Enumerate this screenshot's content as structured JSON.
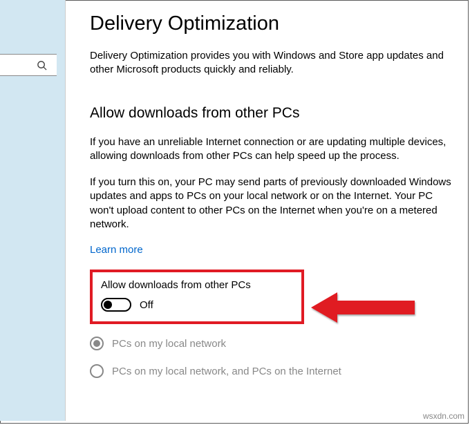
{
  "header": {
    "title": "Delivery Optimization"
  },
  "intro": "Delivery Optimization provides you with Windows and Store app updates and other Microsoft products quickly and reliably.",
  "section": {
    "title": "Allow downloads from other PCs",
    "para1": "If you have an unreliable Internet connection or are updating multiple devices, allowing downloads from other PCs can help speed up the process.",
    "para2": "If you turn this on, your PC may send parts of previously downloaded Windows updates and apps to PCs on your local network or on the Internet. Your PC won't upload content to other PCs on the Internet when you're on a metered network.",
    "learn_more": "Learn more"
  },
  "toggle": {
    "label": "Allow downloads from other PCs",
    "state": "Off"
  },
  "radios": {
    "option1": "PCs on my local network",
    "option2": "PCs on my local network, and PCs on the Internet"
  },
  "watermark": "wsxdn.com"
}
